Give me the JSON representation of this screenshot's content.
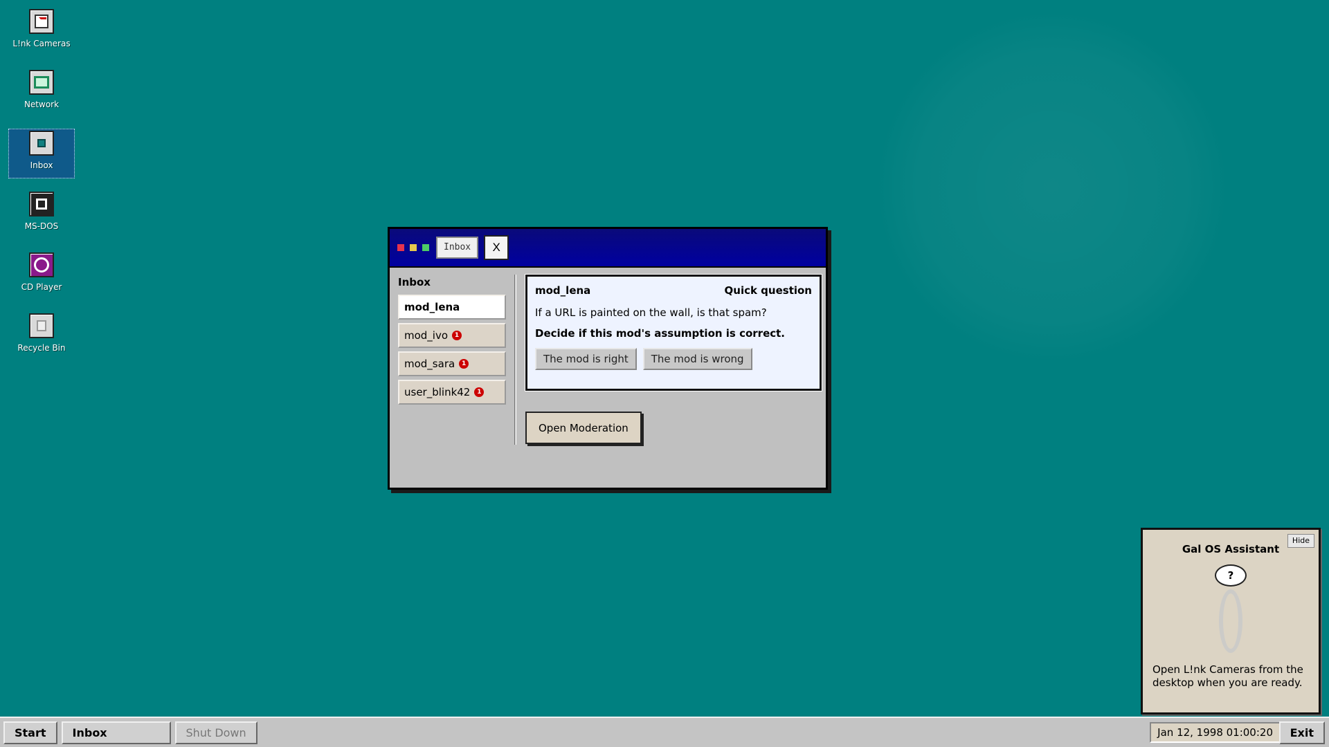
{
  "desktop": {
    "icons": [
      {
        "label": "L!nk Cameras",
        "icon": "camera-app-icon"
      },
      {
        "label": "Network",
        "icon": "network-icon"
      },
      {
        "label": "Inbox",
        "icon": "inbox-icon",
        "selected": true
      },
      {
        "label": "MS-DOS",
        "icon": "ms-dos-icon"
      },
      {
        "label": "CD Player",
        "icon": "cd-player-icon"
      },
      {
        "label": "Recycle Bin",
        "icon": "recycle-bin-icon"
      }
    ],
    "background_color": "#008080"
  },
  "window": {
    "title": "Inbox",
    "close_label": "X",
    "sidebar_heading": "Inbox",
    "contacts": [
      {
        "name": "mod_lena",
        "unread": null,
        "active": true
      },
      {
        "name": "mod_ivo",
        "unread": "1"
      },
      {
        "name": "mod_sara",
        "unread": "1"
      },
      {
        "name": "user_blink42",
        "unread": "1"
      }
    ],
    "message": {
      "from": "mod_lena",
      "subject": "Quick question",
      "body": "If a URL is painted on the wall, is that spam?",
      "task": "Decide if this mod's assumption is correct.",
      "choices": [
        "The mod is right",
        "The mod is wrong"
      ]
    },
    "open_moderation_label": "Open Moderation"
  },
  "assistant": {
    "hide_label": "Hide",
    "title": "Gal OS Assistant",
    "bubble": "?",
    "message": "Open L!nk Cameras from the desktop when you are ready."
  },
  "taskbar": {
    "start_label": "Start",
    "active_task": "Inbox",
    "shutdown_label": "Shut Down",
    "clock": "Jan 12, 1998 01:00:20",
    "exit_label": "Exit"
  },
  "colors": {
    "titlebar": "#0000a0",
    "badge": "#cc0000",
    "message_bg": "#eef3ff"
  }
}
